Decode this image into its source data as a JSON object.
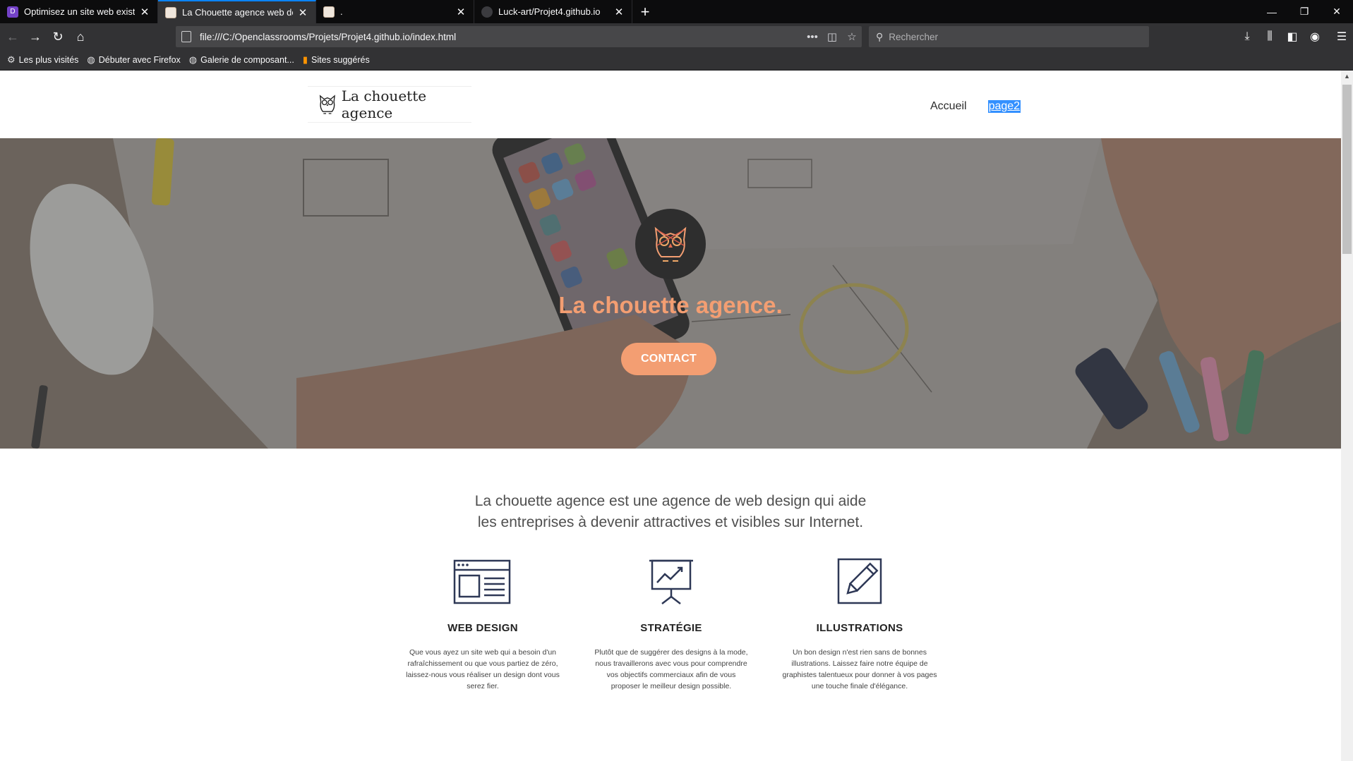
{
  "browser": {
    "tabs": [
      {
        "title": "Optimisez un site web existant",
        "favicon": "openclassrooms-icon",
        "active": false
      },
      {
        "title": "La Chouette agence web design",
        "favicon": "owl-favicon-icon",
        "active": true
      },
      {
        "title": ".",
        "favicon": "owl-favicon-icon",
        "active": false
      },
      {
        "title": "Luck-art/Projet4.github.io",
        "favicon": "github-icon",
        "active": false
      }
    ],
    "url": "file:///C:/Openclassrooms/Projets/Projet4.github.io/index.html",
    "search_placeholder": "Rechercher",
    "bookmarks": [
      {
        "label": "Les plus visités",
        "icon": "gear-icon"
      },
      {
        "label": "Débuter avec Firefox",
        "icon": "globe-icon"
      },
      {
        "label": "Galerie de composant...",
        "icon": "globe-icon"
      },
      {
        "label": "Sites suggérés",
        "icon": "suggested-sites-icon"
      }
    ]
  },
  "site": {
    "logo_text": "La chouette agence",
    "menu": [
      {
        "label": "Accueil",
        "selected": false
      },
      {
        "label": "page2",
        "selected": true
      }
    ],
    "hero": {
      "title": "La chouette agence.",
      "cta": "CONTACT"
    },
    "intro": {
      "line1": "La chouette agence est une agence de web design qui aide",
      "line2": "les entreprises à devenir attractives et visibles sur Internet."
    },
    "services": [
      {
        "icon": "web-design-icon",
        "title": "WEB DESIGN",
        "lines": [
          "Que vous ayez un site web qui a besoin d'un",
          "rafraîchissement ou que vous partiez de zéro,",
          "laissez-nous vous réaliser un design dont vous",
          "serez fier."
        ]
      },
      {
        "icon": "strategy-icon",
        "title": "STRATÉGIE",
        "lines": [
          "Plutôt que de suggérer des designs à la mode,",
          "nous travaillerons avec vous pour comprendre",
          "vos objectifs commerciaux afin de vous",
          "proposer le meilleur design possible."
        ]
      },
      {
        "icon": "illustrations-icon",
        "title": "ILLUSTRATIONS",
        "lines": [
          "Un bon design n'est rien sans de bonnes",
          "illustrations. Laissez faire notre équipe de",
          "graphistes talentueux pour donner à vos pages",
          "une touche finale d'élégance."
        ]
      }
    ]
  },
  "colors": {
    "accent": "#f39e72",
    "selection": "#3390ff",
    "icon_navy": "#2e3856"
  }
}
